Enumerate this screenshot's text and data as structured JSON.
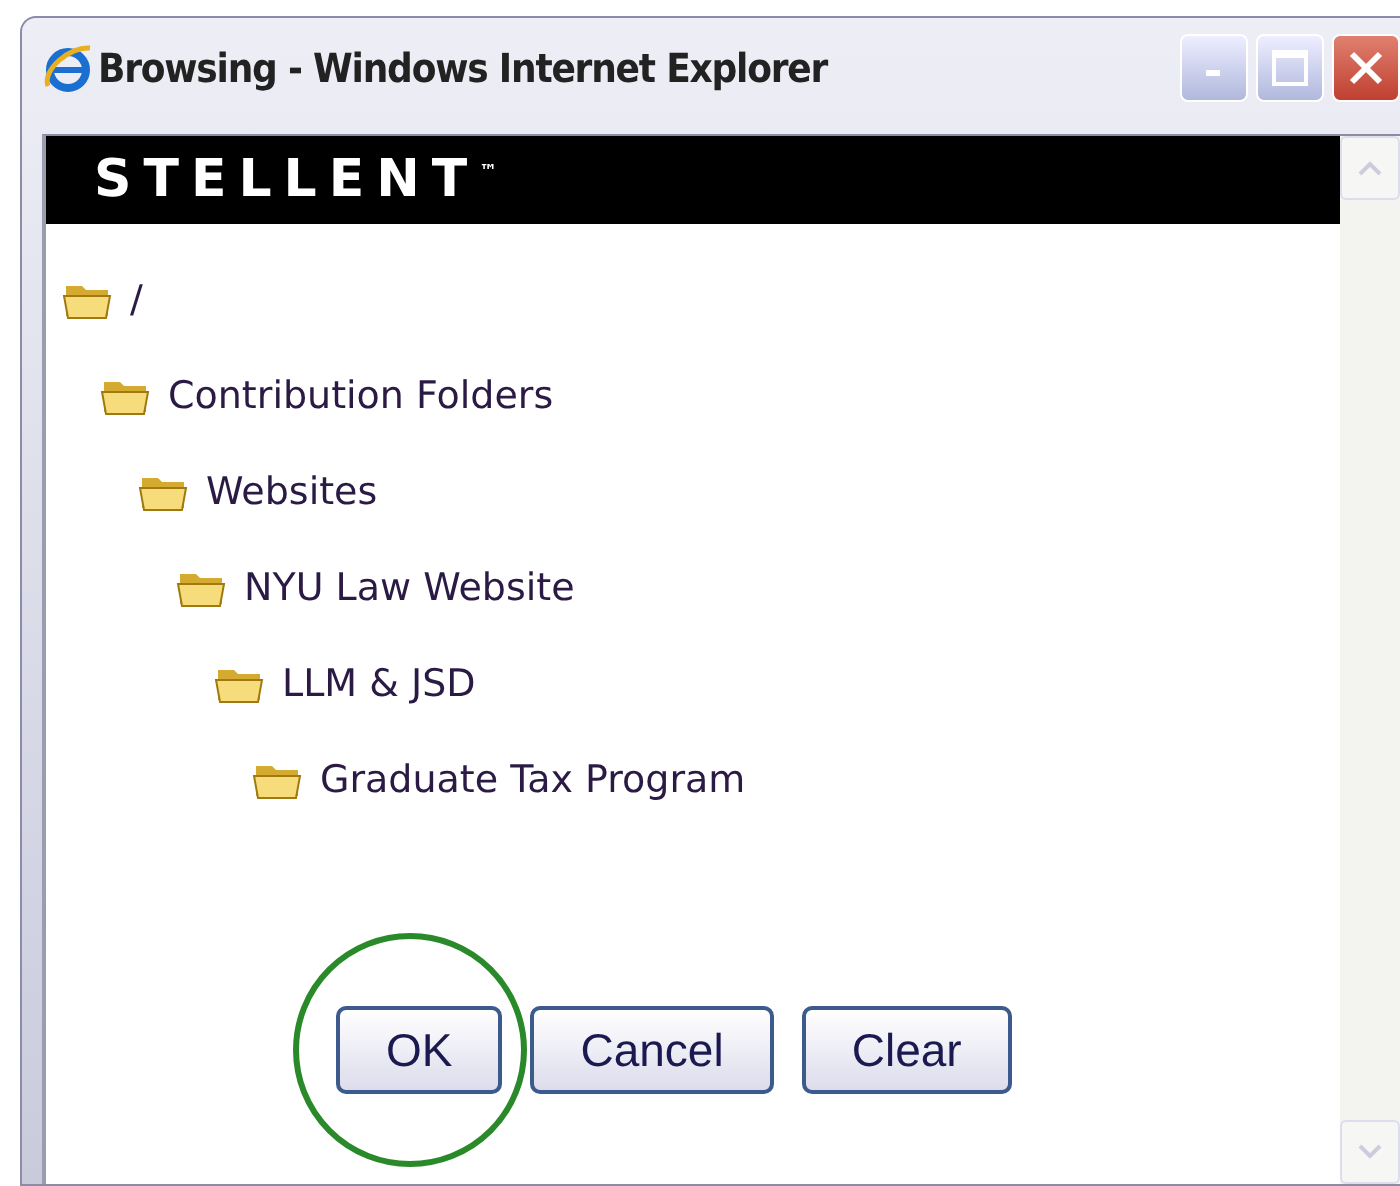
{
  "window": {
    "title": "Browsing - Windows Internet Explorer"
  },
  "banner": {
    "logo": "STELLENT$^{™}$"
  },
  "tree": [
    {
      "label": "/",
      "children": [
        {
          "label": "Contribution Folders",
          "children": [
            {
              "label": "Websites",
              "children": [
                {
                  "label": "NYU Law Website",
                  "children": [
                    {
                      "label": "LLM & JSD",
                      "children": [
                        {
                          "label": "Graduate Tax Program"
                        }
                      ]
                    }
                  ]
                }
              ]
            }
          ]
        }
      ]
    }
  ],
  "buttons": [
    {
      "label": "OK",
      "highlighted": true
    },
    {
      "label": "Cancel",
      "highlighted": false
    },
    {
      "label": "Clear",
      "highlighted": false
    }
  ]
}
